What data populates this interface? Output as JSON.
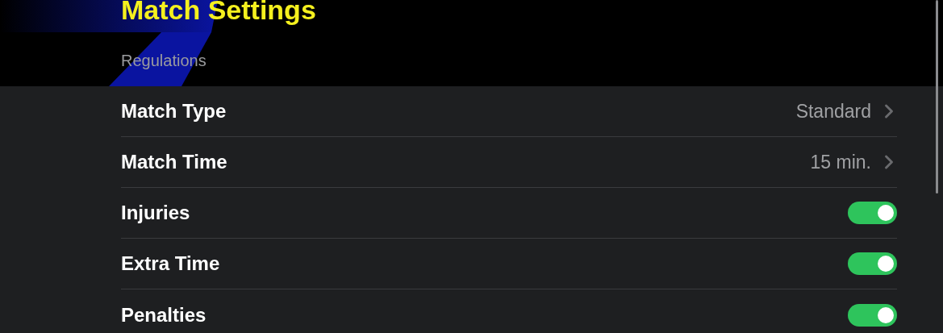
{
  "title": "Match Settings",
  "section": "Regulations",
  "settings": [
    {
      "kind": "select",
      "label": "Match Type",
      "value": "Standard"
    },
    {
      "kind": "select",
      "label": "Match Time",
      "value": "15 min."
    },
    {
      "kind": "toggle",
      "label": "Injuries",
      "on": true
    },
    {
      "kind": "toggle",
      "label": "Extra Time",
      "on": true
    },
    {
      "kind": "toggle",
      "label": "Penalties",
      "on": true
    }
  ]
}
